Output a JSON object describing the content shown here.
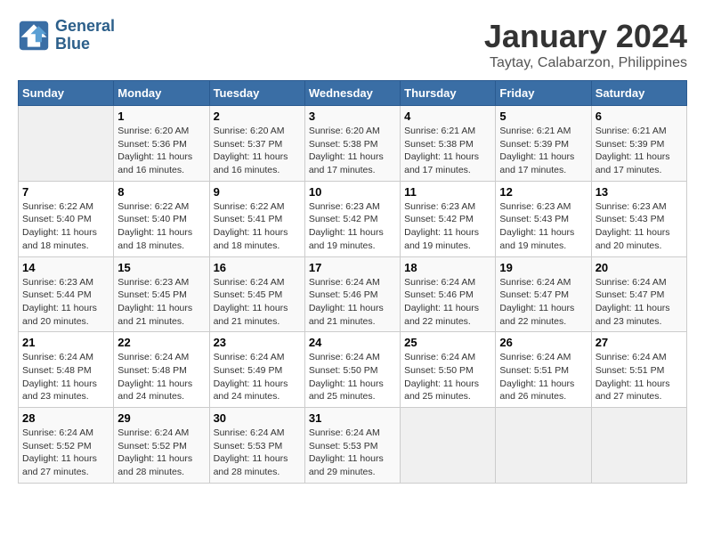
{
  "logo": {
    "line1": "General",
    "line2": "Blue"
  },
  "title": "January 2024",
  "subtitle": "Taytay, Calabarzon, Philippines",
  "days_of_week": [
    "Sunday",
    "Monday",
    "Tuesday",
    "Wednesday",
    "Thursday",
    "Friday",
    "Saturday"
  ],
  "weeks": [
    [
      {
        "day": "",
        "info": ""
      },
      {
        "day": "1",
        "info": "Sunrise: 6:20 AM\nSunset: 5:36 PM\nDaylight: 11 hours\nand 16 minutes."
      },
      {
        "day": "2",
        "info": "Sunrise: 6:20 AM\nSunset: 5:37 PM\nDaylight: 11 hours\nand 16 minutes."
      },
      {
        "day": "3",
        "info": "Sunrise: 6:20 AM\nSunset: 5:38 PM\nDaylight: 11 hours\nand 17 minutes."
      },
      {
        "day": "4",
        "info": "Sunrise: 6:21 AM\nSunset: 5:38 PM\nDaylight: 11 hours\nand 17 minutes."
      },
      {
        "day": "5",
        "info": "Sunrise: 6:21 AM\nSunset: 5:39 PM\nDaylight: 11 hours\nand 17 minutes."
      },
      {
        "day": "6",
        "info": "Sunrise: 6:21 AM\nSunset: 5:39 PM\nDaylight: 11 hours\nand 17 minutes."
      }
    ],
    [
      {
        "day": "7",
        "info": "Sunrise: 6:22 AM\nSunset: 5:40 PM\nDaylight: 11 hours\nand 18 minutes."
      },
      {
        "day": "8",
        "info": "Sunrise: 6:22 AM\nSunset: 5:40 PM\nDaylight: 11 hours\nand 18 minutes."
      },
      {
        "day": "9",
        "info": "Sunrise: 6:22 AM\nSunset: 5:41 PM\nDaylight: 11 hours\nand 18 minutes."
      },
      {
        "day": "10",
        "info": "Sunrise: 6:23 AM\nSunset: 5:42 PM\nDaylight: 11 hours\nand 19 minutes."
      },
      {
        "day": "11",
        "info": "Sunrise: 6:23 AM\nSunset: 5:42 PM\nDaylight: 11 hours\nand 19 minutes."
      },
      {
        "day": "12",
        "info": "Sunrise: 6:23 AM\nSunset: 5:43 PM\nDaylight: 11 hours\nand 19 minutes."
      },
      {
        "day": "13",
        "info": "Sunrise: 6:23 AM\nSunset: 5:43 PM\nDaylight: 11 hours\nand 20 minutes."
      }
    ],
    [
      {
        "day": "14",
        "info": "Sunrise: 6:23 AM\nSunset: 5:44 PM\nDaylight: 11 hours\nand 20 minutes."
      },
      {
        "day": "15",
        "info": "Sunrise: 6:23 AM\nSunset: 5:45 PM\nDaylight: 11 hours\nand 21 minutes."
      },
      {
        "day": "16",
        "info": "Sunrise: 6:24 AM\nSunset: 5:45 PM\nDaylight: 11 hours\nand 21 minutes."
      },
      {
        "day": "17",
        "info": "Sunrise: 6:24 AM\nSunset: 5:46 PM\nDaylight: 11 hours\nand 21 minutes."
      },
      {
        "day": "18",
        "info": "Sunrise: 6:24 AM\nSunset: 5:46 PM\nDaylight: 11 hours\nand 22 minutes."
      },
      {
        "day": "19",
        "info": "Sunrise: 6:24 AM\nSunset: 5:47 PM\nDaylight: 11 hours\nand 22 minutes."
      },
      {
        "day": "20",
        "info": "Sunrise: 6:24 AM\nSunset: 5:47 PM\nDaylight: 11 hours\nand 23 minutes."
      }
    ],
    [
      {
        "day": "21",
        "info": "Sunrise: 6:24 AM\nSunset: 5:48 PM\nDaylight: 11 hours\nand 23 minutes."
      },
      {
        "day": "22",
        "info": "Sunrise: 6:24 AM\nSunset: 5:48 PM\nDaylight: 11 hours\nand 24 minutes."
      },
      {
        "day": "23",
        "info": "Sunrise: 6:24 AM\nSunset: 5:49 PM\nDaylight: 11 hours\nand 24 minutes."
      },
      {
        "day": "24",
        "info": "Sunrise: 6:24 AM\nSunset: 5:50 PM\nDaylight: 11 hours\nand 25 minutes."
      },
      {
        "day": "25",
        "info": "Sunrise: 6:24 AM\nSunset: 5:50 PM\nDaylight: 11 hours\nand 25 minutes."
      },
      {
        "day": "26",
        "info": "Sunrise: 6:24 AM\nSunset: 5:51 PM\nDaylight: 11 hours\nand 26 minutes."
      },
      {
        "day": "27",
        "info": "Sunrise: 6:24 AM\nSunset: 5:51 PM\nDaylight: 11 hours\nand 27 minutes."
      }
    ],
    [
      {
        "day": "28",
        "info": "Sunrise: 6:24 AM\nSunset: 5:52 PM\nDaylight: 11 hours\nand 27 minutes."
      },
      {
        "day": "29",
        "info": "Sunrise: 6:24 AM\nSunset: 5:52 PM\nDaylight: 11 hours\nand 28 minutes."
      },
      {
        "day": "30",
        "info": "Sunrise: 6:24 AM\nSunset: 5:53 PM\nDaylight: 11 hours\nand 28 minutes."
      },
      {
        "day": "31",
        "info": "Sunrise: 6:24 AM\nSunset: 5:53 PM\nDaylight: 11 hours\nand 29 minutes."
      },
      {
        "day": "",
        "info": ""
      },
      {
        "day": "",
        "info": ""
      },
      {
        "day": "",
        "info": ""
      }
    ]
  ]
}
